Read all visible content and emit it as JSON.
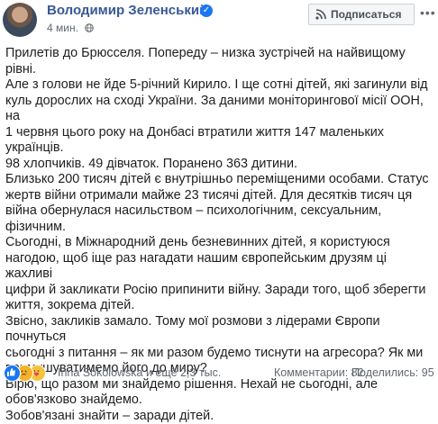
{
  "header": {
    "author": "Володимир Зеленський",
    "time": "4 мин.",
    "subscribe_label": "Подписаться",
    "more_label": "•••"
  },
  "body": {
    "text": "Прилетів до Брюсселя. Попереду – низка зустрічей на найвищому рівні.\nАле з голови не йде 5-річний Кирило. І ще сотні дітей, які загинули від\nкуль дорослих на сході України. За даними моніторингової місії ООН, на\n1 червня цього року на Донбасі втратили життя 147 маленьких українців.\n98 хлопчиків. 49 дівчаток. Поранено 363 дитини.\nБлизько 200 тисяч дітей є внутрішньо переміщеними особами. Статус\nжертв війни отримали майже 23 тисячі дітей. Для десятків тисяч ця\nвійна обернулася насильством – психологічним, сексуальним, фізичним.\nСьогодні, в Міжнародний день безневинних дітей, я користуюся\nнагодою, щоб іще раз нагадати нашим європейським друзям ці жахливі\nцифри й закликати Росію припинити війну. Заради того, щоб зберегти\nжиття, зокрема дітей.\nЗвісно, закликів замало. Тому мої розмови з лідерами Європи почнуться\nсьогодні з питання – як ми разом будемо тиснути на агресора? Як ми\nпримушуватимемо його до миру?\nВірю, що разом ми знайдемо рішення. Нехай не сьогодні, але\nобов'язково знайдемо.\nЗобов'язані знайти – заради дітей."
  },
  "footer": {
    "reactors": "Inna Sokolowska и ещё 2,3 тыс.",
    "comments": "Комментарии: 82",
    "shares": "Поделились: 95"
  },
  "colors": {
    "author": "#385898",
    "text": "#1c1e21",
    "meta": "#616770",
    "verified": "#1877f2"
  }
}
